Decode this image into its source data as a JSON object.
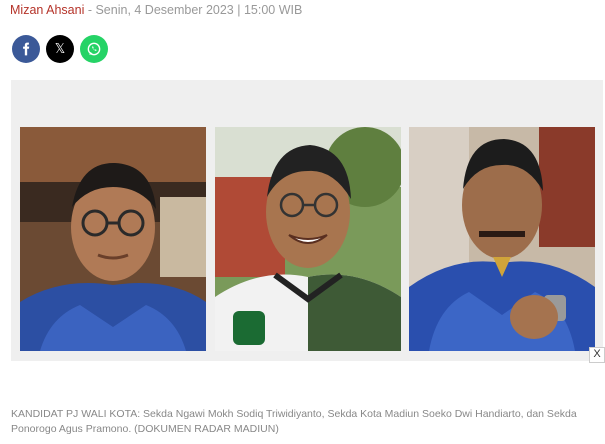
{
  "byline": {
    "author": "Mizan Ahsani",
    "separator": " - ",
    "datetime": "Senin, 4 Desember 2023 | 15:00 WIB"
  },
  "share": {
    "icons": [
      "facebook-icon",
      "x-twitter-icon",
      "whatsapp-icon"
    ],
    "colors": {
      "facebook": "#3b5998",
      "x": "#000000",
      "whatsapp": "#25d366"
    },
    "x_glyph": "𝕏"
  },
  "photos": [
    {
      "subject": "Sekda Ngawi Mokh Sodiq Triwidiyanto"
    },
    {
      "subject": "Sekda Kota Madiun Soeko Dwi Handiarto"
    },
    {
      "subject": "Sekda Ponorogo Agus Pramono"
    }
  ],
  "ad_close": {
    "label": "X"
  },
  "caption": "KANDIDAT PJ WALI KOTA: Sekda Ngawi Mokh Sodiq Triwidiyanto, Sekda Kota Madiun Soeko Dwi Handiarto, dan Sekda Ponorogo Agus Pramono. (DOKUMEN RADAR MADIUN)"
}
